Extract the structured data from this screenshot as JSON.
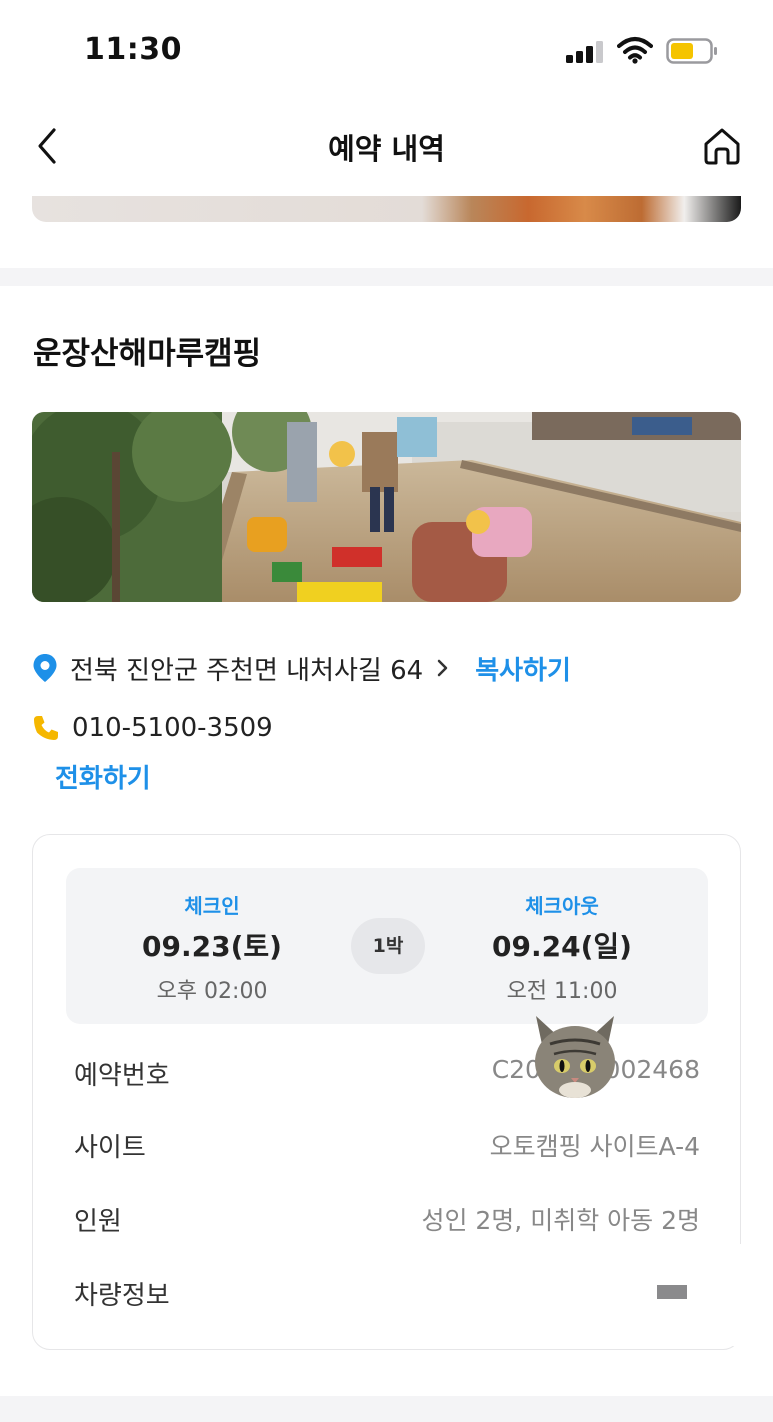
{
  "status_bar": {
    "time": "11:30",
    "icons": [
      "signal-icon",
      "wifi-icon",
      "battery-icon"
    ],
    "battery_color": "#f5c400"
  },
  "nav": {
    "title": "예약 내역",
    "back_icon": "chevron-left-icon",
    "home_icon": "home-icon"
  },
  "campsite": {
    "name": "운장산해마루캠핑",
    "address": "전북 진안군 주천면 내처사길 64",
    "copy_label": "복사하기",
    "phone": "010-5100-3509",
    "call_label": "전화하기"
  },
  "stay": {
    "checkin_label": "체크인",
    "checkin_date": "09.23(토)",
    "checkin_time": "오후 02:00",
    "nights": "1박",
    "checkout_label": "체크아웃",
    "checkout_date": "09.24(일)",
    "checkout_time": "오전 11:00"
  },
  "details": [
    {
      "label": "예약번호",
      "value": "C2023    002468"
    },
    {
      "label": "사이트",
      "value": "오토캠핑 사이트A-4"
    },
    {
      "label": "인원",
      "value": "성인 2명, 미취학 아동 2명"
    },
    {
      "label": "차량정보",
      "value": ""
    }
  ],
  "colors": {
    "accent": "#1e90e8",
    "pin": "#1e90e8",
    "phone_icon": "#f5b700",
    "band": "#f4f4f6"
  }
}
